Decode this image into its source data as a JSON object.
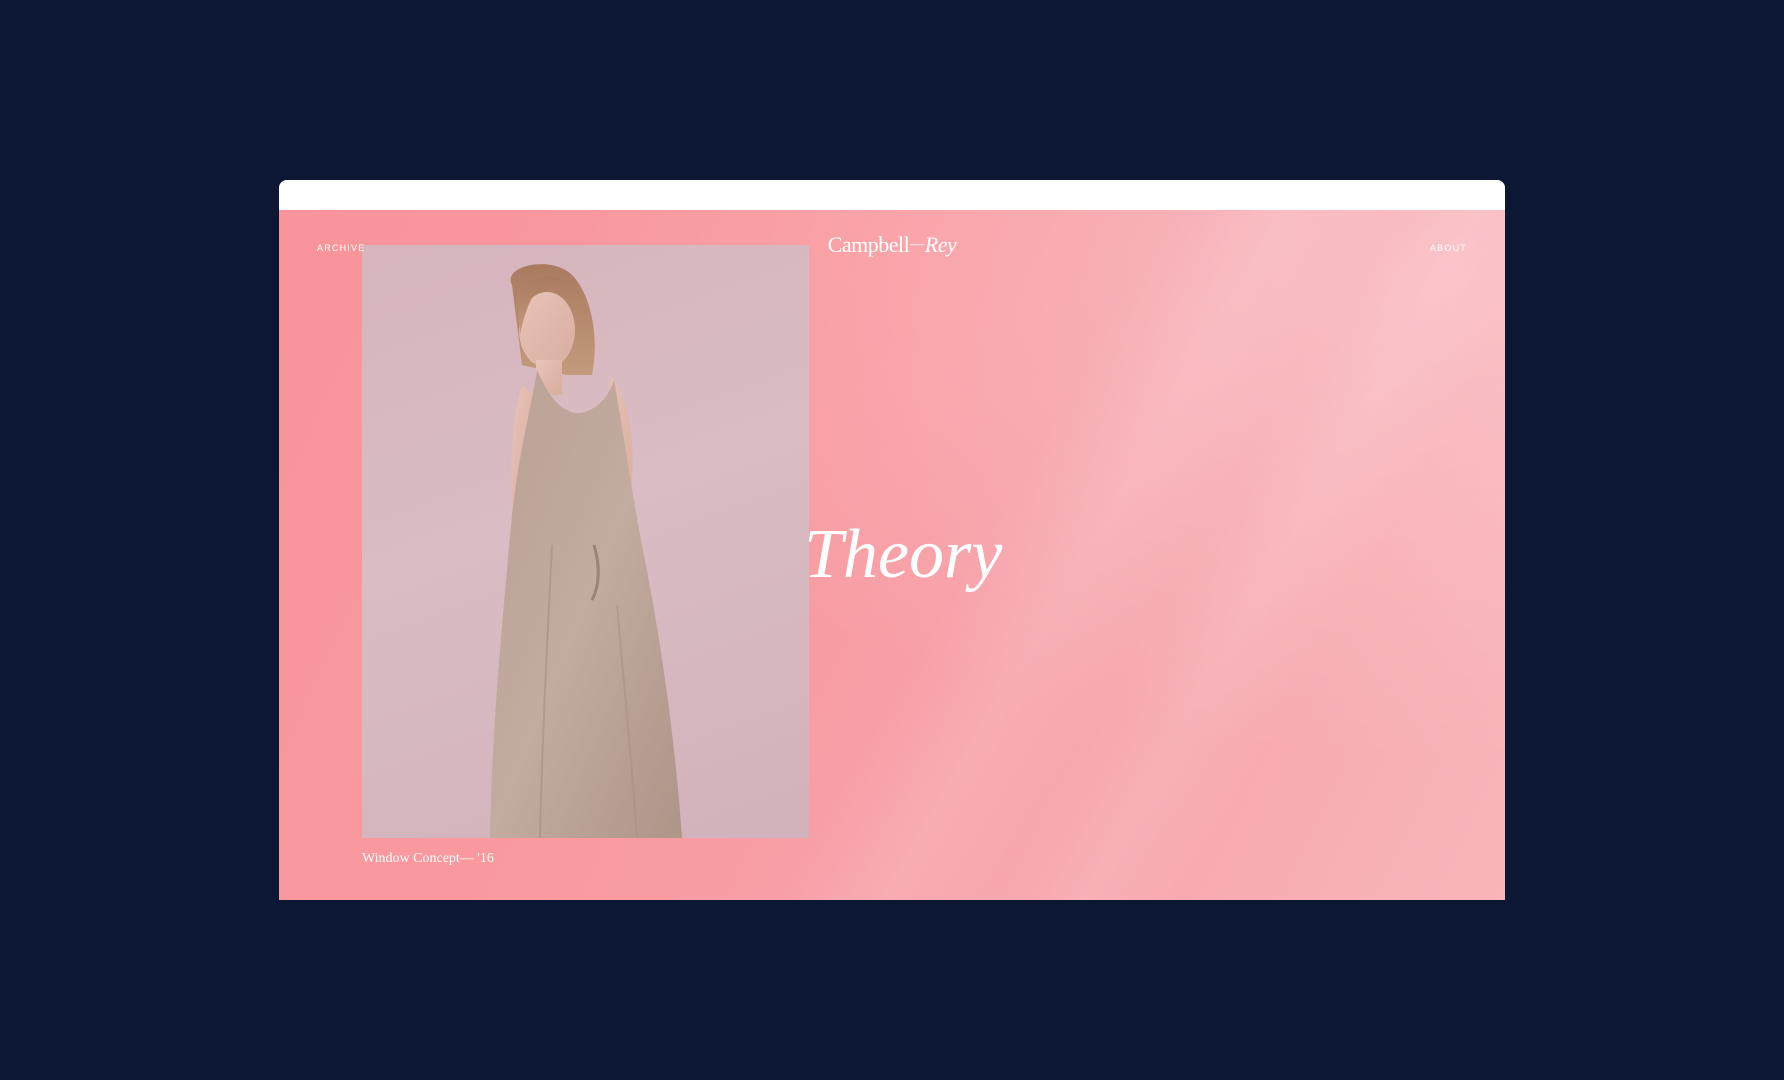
{
  "nav": {
    "left_label": "ARCHIVE",
    "right_label": "ABOUT"
  },
  "brand": {
    "first": "Campbell",
    "separator": "—",
    "second": "Rey"
  },
  "hero": {
    "title": "Theory",
    "caption": "Window Concept— '16",
    "image_subject": "model-in-beige-sleeveless-dress"
  },
  "colors": {
    "outer_background": "#0c1833",
    "page_gradient_start": "#f8949a",
    "page_gradient_end": "#f9b5bb",
    "text": "#ffffff"
  }
}
